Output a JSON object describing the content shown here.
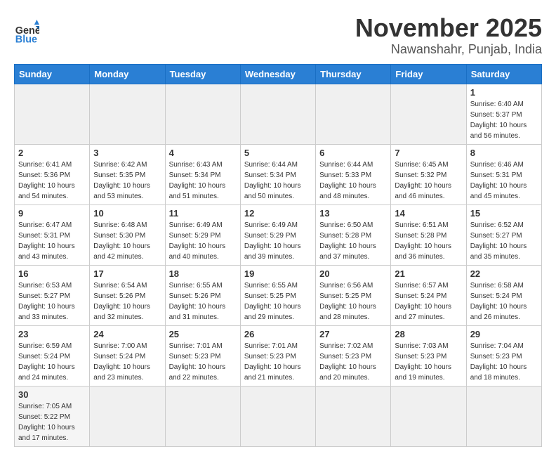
{
  "logo": {
    "general": "General",
    "blue": "Blue"
  },
  "header": {
    "month": "November 2025",
    "location": "Nawanshahr, Punjab, India"
  },
  "weekdays": [
    "Sunday",
    "Monday",
    "Tuesday",
    "Wednesday",
    "Thursday",
    "Friday",
    "Saturday"
  ],
  "weeks": [
    [
      {
        "day": "",
        "info": ""
      },
      {
        "day": "",
        "info": ""
      },
      {
        "day": "",
        "info": ""
      },
      {
        "day": "",
        "info": ""
      },
      {
        "day": "",
        "info": ""
      },
      {
        "day": "",
        "info": ""
      },
      {
        "day": "1",
        "info": "Sunrise: 6:40 AM\nSunset: 5:37 PM\nDaylight: 10 hours and 56 minutes."
      }
    ],
    [
      {
        "day": "2",
        "info": "Sunrise: 6:41 AM\nSunset: 5:36 PM\nDaylight: 10 hours and 54 minutes."
      },
      {
        "day": "3",
        "info": "Sunrise: 6:42 AM\nSunset: 5:35 PM\nDaylight: 10 hours and 53 minutes."
      },
      {
        "day": "4",
        "info": "Sunrise: 6:43 AM\nSunset: 5:34 PM\nDaylight: 10 hours and 51 minutes."
      },
      {
        "day": "5",
        "info": "Sunrise: 6:44 AM\nSunset: 5:34 PM\nDaylight: 10 hours and 50 minutes."
      },
      {
        "day": "6",
        "info": "Sunrise: 6:44 AM\nSunset: 5:33 PM\nDaylight: 10 hours and 48 minutes."
      },
      {
        "day": "7",
        "info": "Sunrise: 6:45 AM\nSunset: 5:32 PM\nDaylight: 10 hours and 46 minutes."
      },
      {
        "day": "8",
        "info": "Sunrise: 6:46 AM\nSunset: 5:31 PM\nDaylight: 10 hours and 45 minutes."
      }
    ],
    [
      {
        "day": "9",
        "info": "Sunrise: 6:47 AM\nSunset: 5:31 PM\nDaylight: 10 hours and 43 minutes."
      },
      {
        "day": "10",
        "info": "Sunrise: 6:48 AM\nSunset: 5:30 PM\nDaylight: 10 hours and 42 minutes."
      },
      {
        "day": "11",
        "info": "Sunrise: 6:49 AM\nSunset: 5:29 PM\nDaylight: 10 hours and 40 minutes."
      },
      {
        "day": "12",
        "info": "Sunrise: 6:49 AM\nSunset: 5:29 PM\nDaylight: 10 hours and 39 minutes."
      },
      {
        "day": "13",
        "info": "Sunrise: 6:50 AM\nSunset: 5:28 PM\nDaylight: 10 hours and 37 minutes."
      },
      {
        "day": "14",
        "info": "Sunrise: 6:51 AM\nSunset: 5:28 PM\nDaylight: 10 hours and 36 minutes."
      },
      {
        "day": "15",
        "info": "Sunrise: 6:52 AM\nSunset: 5:27 PM\nDaylight: 10 hours and 35 minutes."
      }
    ],
    [
      {
        "day": "16",
        "info": "Sunrise: 6:53 AM\nSunset: 5:27 PM\nDaylight: 10 hours and 33 minutes."
      },
      {
        "day": "17",
        "info": "Sunrise: 6:54 AM\nSunset: 5:26 PM\nDaylight: 10 hours and 32 minutes."
      },
      {
        "day": "18",
        "info": "Sunrise: 6:55 AM\nSunset: 5:26 PM\nDaylight: 10 hours and 31 minutes."
      },
      {
        "day": "19",
        "info": "Sunrise: 6:55 AM\nSunset: 5:25 PM\nDaylight: 10 hours and 29 minutes."
      },
      {
        "day": "20",
        "info": "Sunrise: 6:56 AM\nSunset: 5:25 PM\nDaylight: 10 hours and 28 minutes."
      },
      {
        "day": "21",
        "info": "Sunrise: 6:57 AM\nSunset: 5:24 PM\nDaylight: 10 hours and 27 minutes."
      },
      {
        "day": "22",
        "info": "Sunrise: 6:58 AM\nSunset: 5:24 PM\nDaylight: 10 hours and 26 minutes."
      }
    ],
    [
      {
        "day": "23",
        "info": "Sunrise: 6:59 AM\nSunset: 5:24 PM\nDaylight: 10 hours and 24 minutes."
      },
      {
        "day": "24",
        "info": "Sunrise: 7:00 AM\nSunset: 5:24 PM\nDaylight: 10 hours and 23 minutes."
      },
      {
        "day": "25",
        "info": "Sunrise: 7:01 AM\nSunset: 5:23 PM\nDaylight: 10 hours and 22 minutes."
      },
      {
        "day": "26",
        "info": "Sunrise: 7:01 AM\nSunset: 5:23 PM\nDaylight: 10 hours and 21 minutes."
      },
      {
        "day": "27",
        "info": "Sunrise: 7:02 AM\nSunset: 5:23 PM\nDaylight: 10 hours and 20 minutes."
      },
      {
        "day": "28",
        "info": "Sunrise: 7:03 AM\nSunset: 5:23 PM\nDaylight: 10 hours and 19 minutes."
      },
      {
        "day": "29",
        "info": "Sunrise: 7:04 AM\nSunset: 5:23 PM\nDaylight: 10 hours and 18 minutes."
      }
    ],
    [
      {
        "day": "30",
        "info": "Sunrise: 7:05 AM\nSunset: 5:22 PM\nDaylight: 10 hours and 17 minutes."
      },
      {
        "day": "",
        "info": ""
      },
      {
        "day": "",
        "info": ""
      },
      {
        "day": "",
        "info": ""
      },
      {
        "day": "",
        "info": ""
      },
      {
        "day": "",
        "info": ""
      },
      {
        "day": "",
        "info": ""
      }
    ]
  ]
}
